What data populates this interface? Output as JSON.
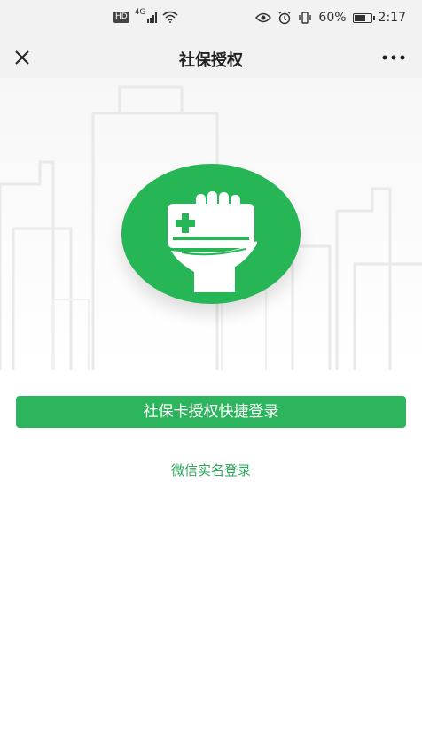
{
  "status_bar": {
    "hd": "HD",
    "network": "4G",
    "battery_percent": "60%",
    "battery_level": 0.6,
    "time": "2:17",
    "icons": [
      "signal-icon",
      "wifi-icon",
      "eye-icon",
      "alarm-icon",
      "vibrate-icon",
      "battery-icon"
    ]
  },
  "nav": {
    "title": "社保授权",
    "close_icon": "close-icon",
    "more_icon": "more-icon"
  },
  "hero": {
    "icon": "hand-holding-card-icon",
    "accent_color": "#27b655"
  },
  "actions": {
    "primary_label": "社保卡授权快捷登录",
    "primary_color": "#2db55d",
    "secondary_label": "微信实名登录",
    "secondary_color": "#2aa85a"
  }
}
